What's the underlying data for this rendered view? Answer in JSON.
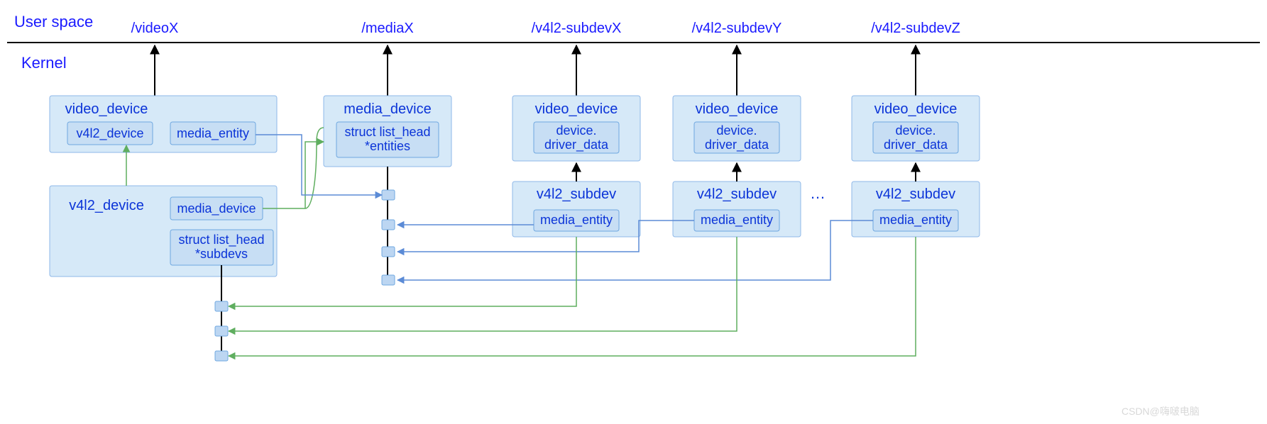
{
  "labels": {
    "user_space": "User space",
    "kernel": "Kernel",
    "dots": "…"
  },
  "devices": {
    "videoX": "/videoX",
    "mediaX": "/mediaX",
    "subdevX": "/v4l2-subdevX",
    "subdevY": "/v4l2-subdevY",
    "subdevZ": "/v4l2-subdevZ"
  },
  "kernel_boxes": {
    "video_device": {
      "title": "video_device",
      "sub1": "v4l2_device",
      "sub2": "media_entity"
    },
    "media_device": {
      "title": "media_device",
      "sub": "struct list_head\n*entities"
    },
    "subdev_video_device": {
      "title": "video_device",
      "sub": "device.\ndriver_data"
    },
    "v4l2_device": {
      "title": "v4l2_device",
      "sub1": "media_device",
      "sub2": "struct list_head\n*subdevs"
    },
    "v4l2_subdev": {
      "title": "v4l2_subdev",
      "sub": "media_entity"
    }
  },
  "watermark": "CSDN@嗨啵电脑"
}
